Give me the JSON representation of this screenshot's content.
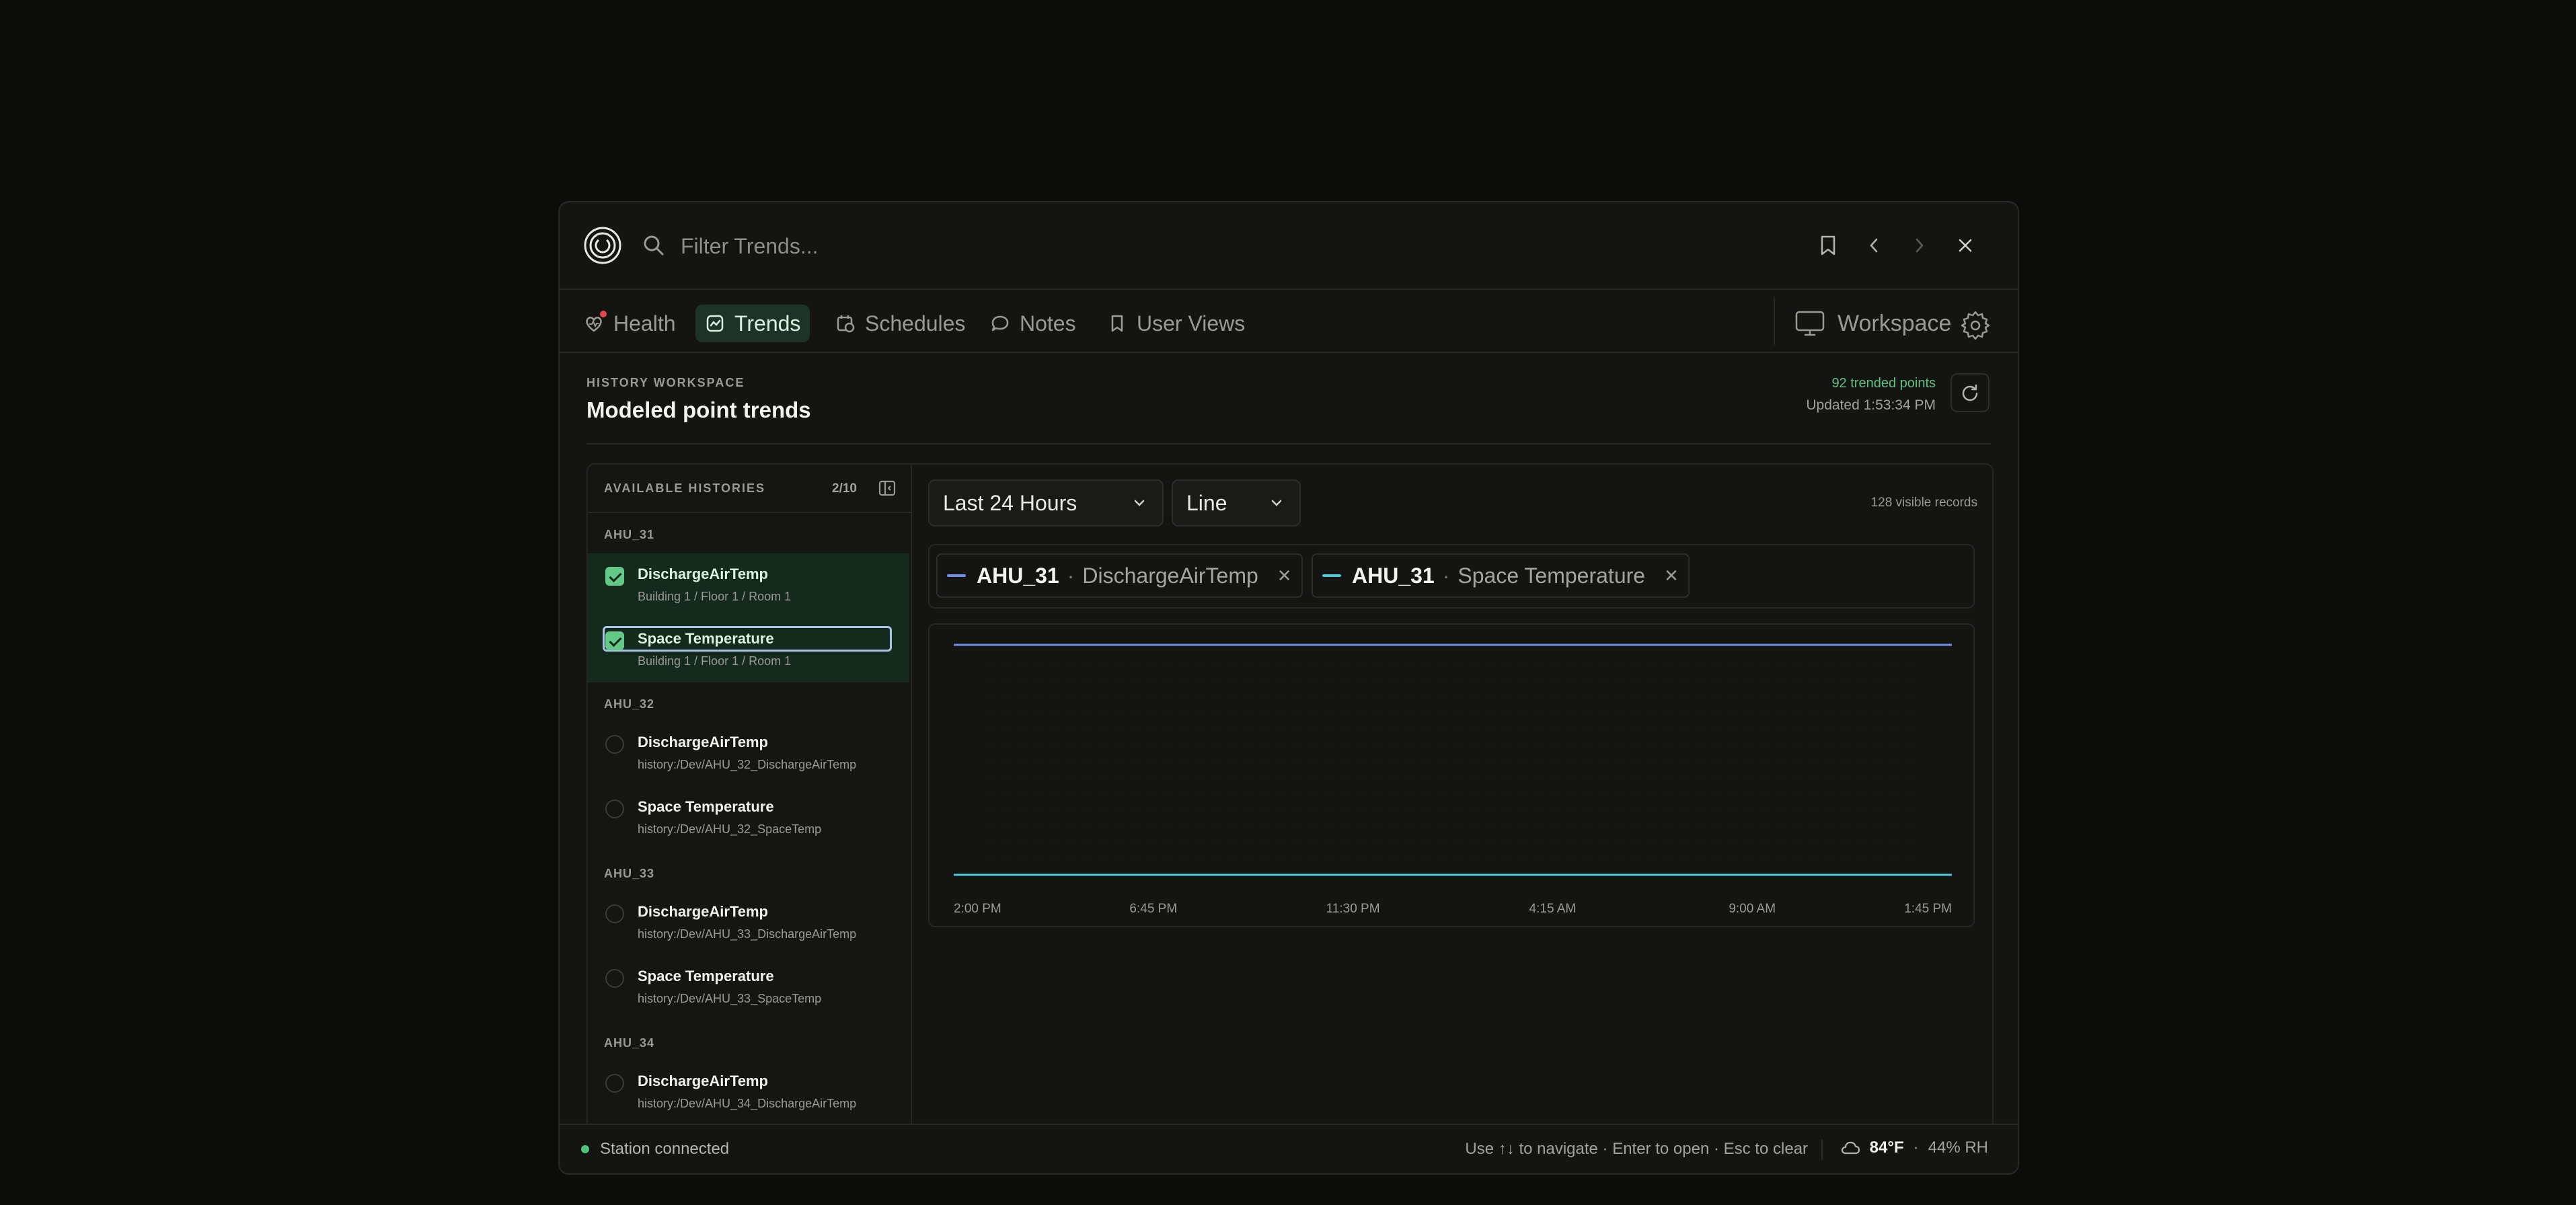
{
  "search": {
    "placeholder": "Filter Trends..."
  },
  "nav": {
    "tabs": [
      {
        "label": "Health",
        "icon": "heart-pulse-icon"
      },
      {
        "label": "Trends",
        "icon": "chart-icon",
        "active": true
      },
      {
        "label": "Schedules",
        "icon": "calendar-clock-icon"
      },
      {
        "label": "Notes",
        "icon": "message-icon"
      },
      {
        "label": "User Views",
        "icon": "bookmark-icon"
      }
    ],
    "workspace_label": "Workspace"
  },
  "header": {
    "eyebrow": "HISTORY WORKSPACE",
    "title": "Modeled point trends",
    "trended_points": "92 trended points",
    "updated": "Updated 1:53:34 PM"
  },
  "sidebar": {
    "title": "AVAILABLE HISTORIES",
    "count": "2/10",
    "groups": [
      {
        "name": "AHU_31",
        "items": [
          {
            "name": "DischargeAirTemp",
            "path": "Building 1  /  Floor 1  /  Room 1",
            "checked": true
          },
          {
            "name": "Space Temperature",
            "path": "Building 1  /  Floor 1  /  Room 1",
            "checked": true
          }
        ]
      },
      {
        "name": "AHU_32",
        "items": [
          {
            "name": "DischargeAirTemp",
            "path": "history:/Dev/AHU_32_DischargeAirTemp",
            "checked": false
          },
          {
            "name": "Space Temperature",
            "path": "history:/Dev/AHU_32_SpaceTemp",
            "checked": false
          }
        ]
      },
      {
        "name": "AHU_33",
        "items": [
          {
            "name": "DischargeAirTemp",
            "path": "history:/Dev/AHU_33_DischargeAirTemp",
            "checked": false
          },
          {
            "name": "Space Temperature",
            "path": "history:/Dev/AHU_33_SpaceTemp",
            "checked": false
          }
        ]
      },
      {
        "name": "AHU_34",
        "items": [
          {
            "name": "DischargeAirTemp",
            "path": "history:/Dev/AHU_34_DischargeAirTemp",
            "checked": false
          }
        ]
      }
    ]
  },
  "controls": {
    "range": "Last 24 Hours",
    "chart_type": "Line",
    "visible_records": "128 visible records"
  },
  "legend": [
    {
      "equip": "AHU_31",
      "sep": "·",
      "point": "DischargeAirTemp",
      "color": "#6f8fe6"
    },
    {
      "equip": "AHU_31",
      "sep": "·",
      "point": "Space Temperature",
      "color": "#4fc8d8"
    }
  ],
  "chart_data": {
    "type": "line",
    "x": [
      "2:00 PM",
      "6:45 PM",
      "11:30 PM",
      "4:15 AM",
      "9:00 AM",
      "1:45 PM"
    ],
    "series": [
      {
        "name": "AHU_31 · DischargeAirTemp",
        "color": "#6f8fe6",
        "level": 1.0
      },
      {
        "name": "AHU_31 · Space Temperature",
        "color": "#4fc8d8",
        "level": 0.0
      }
    ],
    "grid": "dots"
  },
  "status": {
    "connection": "Station connected",
    "hint": "Use ↑↓ to navigate · Enter to open · Esc to clear",
    "temp": "84°F",
    "sep": "·",
    "humidity": "44% RH"
  },
  "colors": {
    "accent": "#62c987",
    "selected_bg": "#142a1d",
    "alert": "#e5484d"
  }
}
